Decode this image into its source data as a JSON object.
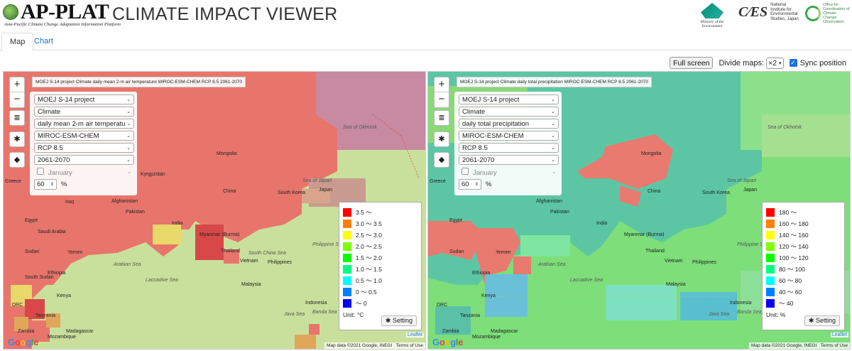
{
  "header": {
    "logo_text": "AP-PLAT",
    "logo_subtitle": "Asia-Pacific Climate Change Adaptation Information Platform",
    "app_title": "CLIMATE IMPACT VIEWER",
    "partners": {
      "env": "Ministry of the Environment",
      "nies_mark": "CGER",
      "nies_lines": [
        "National",
        "Institute for",
        "Environmental",
        "Studies, Japan"
      ],
      "coord_lines": [
        "Office for",
        "Coordination of",
        "Climate",
        "Change",
        "Observation"
      ]
    }
  },
  "tabs": [
    {
      "label": "Map",
      "active": true
    },
    {
      "label": "Chart",
      "active": false
    }
  ],
  "toolbar": {
    "full_screen": "Full screen",
    "divide_label": "Divide maps:",
    "divide_value": "×2",
    "sync_label": "Sync position",
    "sync_checked": true
  },
  "maps": [
    {
      "title": "MOEJ S-14 project Climate daily mean 2-m air temperature MIROC-ESM-CHEM RCP 8.5 2061-2070",
      "selects": [
        "MOEJ S-14 project",
        "Climate",
        "daily mean 2-m air temperatu",
        "MIROC-ESM-CHEM",
        "RCP 8.5",
        "2061-2070"
      ],
      "month": "January",
      "opacity": "60",
      "opacity_unit": "%",
      "legend": {
        "items": [
          {
            "label": "3.5 ～",
            "color": "#ff0000"
          },
          {
            "label": "3.0 ～ 3.5",
            "color": "#ff8000"
          },
          {
            "label": "2.5 ～ 3.0",
            "color": "#ffff00"
          },
          {
            "label": "2.0 ～ 2.5",
            "color": "#80ff00"
          },
          {
            "label": "1.5 ～ 2.0",
            "color": "#00ff00"
          },
          {
            "label": "1.0 ～ 1.5",
            "color": "#00ff80"
          },
          {
            "label": "0.5 ～ 1.0",
            "color": "#00ffff"
          },
          {
            "label": "0 ～ 0.5",
            "color": "#0080ff"
          },
          {
            "label": "～ 0",
            "color": "#0000ff"
          }
        ],
        "unit": "Unit: °C",
        "setting": "Setting"
      }
    },
    {
      "title": "MOEJ S-14 project Climate daily total precipitation MIROC-ESM-CHEM RCP 8.5 2061-2070",
      "selects": [
        "MOEJ S-14 project",
        "Climate",
        "daily total precipitation",
        "MIROC-ESM-CHEM",
        "RCP 8.5",
        "2061-2070"
      ],
      "month": "January",
      "opacity": "60",
      "opacity_unit": "%",
      "legend": {
        "items": [
          {
            "label": "180 ～",
            "color": "#ff0000"
          },
          {
            "label": "160 ～ 180",
            "color": "#ff8000"
          },
          {
            "label": "140 ～ 160",
            "color": "#ffff00"
          },
          {
            "label": "120 ～ 140",
            "color": "#80ff00"
          },
          {
            "label": "100 ～ 120",
            "color": "#00ff00"
          },
          {
            "label": "80 ～ 100",
            "color": "#00ff80"
          },
          {
            "label": "60 ～ 80",
            "color": "#00ffff"
          },
          {
            "label": "40 ～ 60",
            "color": "#0080ff"
          },
          {
            "label": "～ 40",
            "color": "#0000ff"
          }
        ],
        "unit": "Unit: %",
        "setting": "Setting"
      }
    }
  ],
  "map_labels_left": [
    "Greece",
    "Egypt",
    "Iraq",
    "Saudi Arabia",
    "Sudan",
    "Yemen",
    "Ethiopia",
    "South Sudan",
    "Kenya",
    "DRC",
    "Tanzania",
    "Afghanistan",
    "Pakistan",
    "India",
    "Kyrgyzstan",
    "Mongolia",
    "China",
    "South Korea",
    "Japan",
    "Sea of Japan",
    "Sea of Okhotsk",
    "Myanmar (Burma)",
    "Thailand",
    "Vietnam",
    "Philippines",
    "South China Sea",
    "Philippine Sea",
    "Malaysia",
    "Indonesia",
    "Arabian Sea",
    "Laccadive Sea",
    "Java Sea",
    "Banda Sea",
    "Zambia",
    "Mozambique",
    "Madagascar"
  ],
  "map_labels_right": [
    "Greece",
    "Egypt",
    "Sudan",
    "Yemen",
    "Ethiopia",
    "Kenya",
    "DRC",
    "Tanzania",
    "Afghanistan",
    "Pakistan",
    "India",
    "Mongolia",
    "China",
    "South Korea",
    "Japan",
    "Sea of Japan",
    "Sea of Okhotsk",
    "Myanmar (Burma)",
    "Thailand",
    "Vietnam",
    "Philippines",
    "Philippine Sea",
    "Malaysia",
    "Indonesia",
    "Arabian Sea",
    "Laccadive Sea",
    "Java Sea",
    "Banda Sea",
    "Zambia",
    "Mozambique",
    "Madagascar"
  ],
  "footer": {
    "google": "Google",
    "attribution": "Map data ©2021 Google, INEGI",
    "terms": "Terms of Use",
    "leaflet": "Leaflet"
  },
  "colors": {
    "link": "#1a6fd0",
    "temp_fill": "#e8776e",
    "temp_ocean": "#c6e09a",
    "precip_land": "#5ac8a8",
    "precip_ocean": "#7ee07a"
  }
}
